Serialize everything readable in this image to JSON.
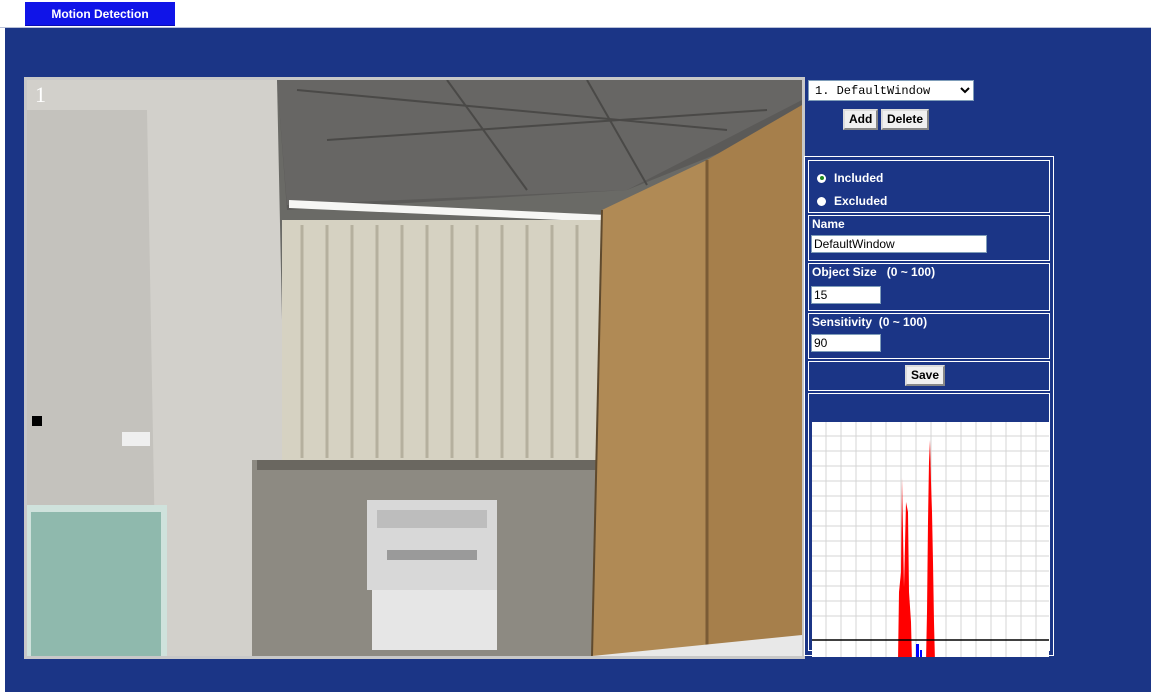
{
  "tab": {
    "label": "Motion Detection"
  },
  "video": {
    "camera_number": "1"
  },
  "window_select": {
    "options": [
      "1. DefaultWindow"
    ],
    "selected": "1. DefaultWindow"
  },
  "buttons": {
    "add": "Add",
    "delete": "Delete",
    "save": "Save"
  },
  "mode": {
    "included": "Included",
    "excluded": "Excluded",
    "selected": "Included"
  },
  "name": {
    "label": "Name",
    "value": "DefaultWindow"
  },
  "object_size": {
    "label": "Object Size",
    "range": "(0 ~ 100)",
    "value": "15"
  },
  "sensitivity": {
    "label": "Sensitivity",
    "range": "(0 ~ 100)",
    "value": "90"
  },
  "colors": {
    "background": "#1b3586",
    "tab": "#1014e8",
    "chart_red": "#ff0000",
    "chart_blue": "#0000ff",
    "chart_footer": "#1b3586"
  }
}
